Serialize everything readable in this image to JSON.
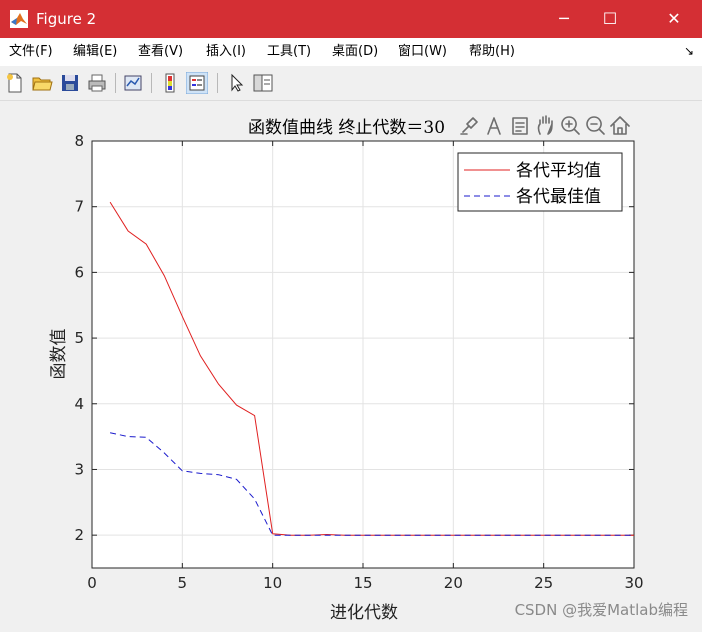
{
  "window": {
    "title": "Figure 2"
  },
  "menu": [
    "文件(F)",
    "编辑(E)",
    "查看(V)",
    "插入(I)",
    "工具(T)",
    "桌面(D)",
    "窗口(W)",
    "帮助(H)"
  ],
  "axes_toolbar_icons": [
    "brush-icon",
    "data-tip-icon",
    "legend-icon",
    "pan-icon",
    "zoom-in-icon",
    "zoom-out-icon",
    "home-icon"
  ],
  "chart_data": {
    "type": "line",
    "title": "函数值曲线  终止代数＝30",
    "xlabel": "进化代数",
    "ylabel": "函数值",
    "xlim": [
      0,
      30
    ],
    "ylim": [
      1.5,
      8
    ],
    "xticks": [
      0,
      5,
      10,
      15,
      20,
      25,
      30
    ],
    "yticks": [
      2,
      3,
      4,
      5,
      6,
      7,
      8
    ],
    "grid": true,
    "legend_position": "top-right",
    "series": [
      {
        "name": "各代平均值",
        "color": "#e02020",
        "style": "solid",
        "x": [
          1,
          2,
          3,
          4,
          5,
          6,
          7,
          8,
          9,
          10,
          11,
          12,
          13,
          14,
          15,
          16,
          17,
          18,
          19,
          20,
          21,
          22,
          23,
          24,
          25,
          26,
          27,
          28,
          29,
          30
        ],
        "y": [
          7.07,
          6.63,
          6.43,
          5.95,
          5.33,
          4.73,
          4.3,
          3.98,
          3.82,
          2.02,
          2.0,
          2.0,
          2.01,
          2.0,
          2.0,
          2.0,
          2.0,
          2.0,
          2.0,
          2.0,
          2.0,
          2.0,
          2.0,
          2.0,
          2.0,
          2.0,
          2.0,
          2.0,
          2.0,
          2.0
        ]
      },
      {
        "name": "各代最佳值",
        "color": "#1a1acc",
        "style": "dashed",
        "x": [
          1,
          2,
          3,
          4,
          5,
          6,
          7,
          8,
          9,
          10,
          11,
          12,
          13,
          14,
          15,
          16,
          17,
          18,
          19,
          20,
          21,
          22,
          23,
          24,
          25,
          26,
          27,
          28,
          29,
          30
        ],
        "y": [
          3.56,
          3.5,
          3.49,
          3.25,
          2.98,
          2.94,
          2.92,
          2.85,
          2.55,
          2.0,
          2.0,
          2.0,
          2.0,
          2.0,
          2.0,
          2.0,
          2.0,
          2.0,
          2.0,
          2.0,
          2.0,
          2.0,
          2.0,
          2.0,
          2.0,
          2.0,
          2.0,
          2.0,
          2.0,
          2.0
        ]
      }
    ]
  },
  "watermark": "CSDN @我爱Matlab编程"
}
